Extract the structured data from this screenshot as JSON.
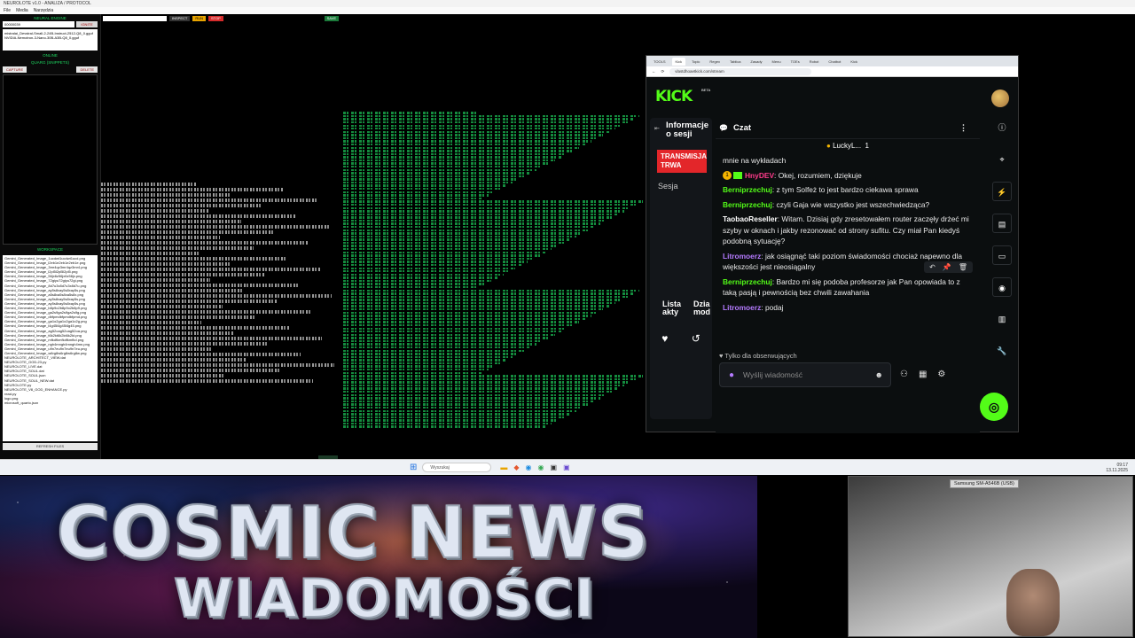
{
  "app": {
    "title": "NEUROLOTE v1.0 - ANALIZA / PROTOCOL",
    "menu": [
      "File",
      "Media",
      "Narzędzia"
    ]
  },
  "left_panel": {
    "engine_title": "NEURAL ENGINE",
    "engine_input": "00000039",
    "engine_button": "IGNITE",
    "model_text": "mistralai_Devstral-Small-2-24B-Instruct-2512-Q8_0.gguf NVIDIA-Nemotron-3-Nano-30B-A3B-Q8_0.gguf",
    "status": "ONLINE",
    "snippets_title": "QUARG (SNIPPETS)",
    "capture_btn": "CAPTURE",
    "delete_btn": "DELETE",
    "workspace_title": "WORKSPACE",
    "files": [
      "Gemini_Generated_Image_1ucdwt1ucdwt1ucd.png",
      "Gemini_Generated_Image_l2eb1e2eb1e2eb1e.png",
      "Gemini_Generated_Image_3mr4qz3mr4qz3mr4.png",
      "Gemini_Generated_Image_l2pl5l2pl5l2pl5.png",
      "Gemini_Generated_Image_56jx6z56jx6z56jx.png",
      "Gemini_Generated_Image_72giyu72giyu72gi.png",
      "Gemini_Generated_Image_8d7u3x8d7u3x8d7u.png",
      "Gemini_Generated_Image_ay5s8xay5s8xay5s.png",
      "Gemini_Generated_Image_a5s8xa5s8xa5s8x.png",
      "Gemini_Generated_Image_ay5s8xay5s8xay5s.png",
      "Gemini_Generated_Image_ay5s8xay5s8xay5s.png",
      "Gemini_Generated_Image_b8p9o2b8p9o2b8p9.png",
      "Gemini_Generated_Image_ga2s9ga2s9ga2s9g.png",
      "Gemini_Generated_Image_dbfpmdbfpmdbfpmd.png",
      "Gemini_Generated_Image_ga1o2ga1o2ga1o2g.png",
      "Gemini_Generated_Image_l4g45l4g45l4g45.png",
      "Gemini_Generated_Image_ag52oag52oag52oa.png",
      "Gemini_Generated_Image_t6k2kt6k2kt6k2kt.png",
      "Gemini_Generated_Image_mfkdfkmfkdfkmfkd.png",
      "Gemini_Generated_Image_ngh4mngh4mngh4mn.png",
      "Gemini_Generated_Image_u9n7eu9n7eu9n7eu.png",
      "Gemini_Generated_Image_w6rg8w6rg8w6rg8w.png",
      "NEUROLOTE_ARCHITECT_VIEW.dat",
      "NEUROLOTE_GOD-23.py",
      "NEUROLOTE_LIVE.dat",
      "NEUROLOTE_SOUL.dat",
      "NEUROLOTE_SOUL.json",
      "NEUROLOTE_SOUL_NEW.dat",
      "NEUROLOTE.py",
      "NEUROLOTE_V8_GOD_ENHANCE.py",
      "read.py",
      "logo.png",
      "microsoft_quarto.json"
    ],
    "refresh_btn": "REFRESH FILES"
  },
  "mid_panel": {
    "inspect": "INSPECT",
    "run": "RUN",
    "stop": "STOP",
    "save": "SAVE",
    "send": "SEND"
  },
  "browser": {
    "tabs": [
      "TOOLS",
      "Kick",
      "Topic",
      "Regex",
      "Tablica",
      "Zasady",
      "Menu",
      "TOEs",
      "Robot",
      "Chatbot",
      "Kick"
    ],
    "url": "vlastdhoaetkick.com/stream"
  },
  "kick": {
    "logo": "KICK",
    "beta": "BETA",
    "session_title": "Informacje o sesji",
    "live_badge": "TRANSMISJA TRWA",
    "session_item": "Sesja",
    "bottom_left": "Lista akty",
    "bottom_right": "Dzia mod",
    "chat_title": "Czat",
    "pinned_user": "LuckyL...",
    "pinned_count": "1",
    "messages": [
      {
        "user": "",
        "color": "white",
        "text": "mnie na wykładach"
      },
      {
        "user": "HnyDEV",
        "color": "pink",
        "badges": true,
        "text": "Okej, rozumiem, dziękuje"
      },
      {
        "user": "Berniprzechuj",
        "color": "green",
        "text": "z tym Solfeż to jest bardzo ciekawa sprawa"
      },
      {
        "user": "Berniprzechuj",
        "color": "green",
        "text": "czyli Gaja wie wszystko jest wszechwiedząca?"
      },
      {
        "user": "TaobaoReseller",
        "color": "white",
        "text": "Witam. Dzisiaj gdy zresetowałem router zaczęły drżeć mi szyby w oknach i jakby rezonować od strony sufitu. Czy miał Pan kiedyś podobną sytuację?"
      },
      {
        "user": "Litromoerz",
        "color": "purple",
        "text": "jak osiągnąć taki poziom świadomości chociaż napewno dla większości jest nieosiągalny"
      },
      {
        "user": "Berniprzechuj",
        "color": "green",
        "text": "Bardzo mi się podoba profesorze jak Pan opowiada to z taką pasją i pewnością bez chwili zawahania"
      },
      {
        "user": "Litromoerz",
        "color": "purple",
        "text": "podaj"
      }
    ],
    "followers_only": "Tylko dla obserwujących",
    "input_placeholder": "Wyślij wiadomość"
  },
  "taskbar": {
    "search": "Wyszukaj",
    "time": "09:17",
    "date": "13.11.2025"
  },
  "banner": {
    "title": "COSMIC NEWS",
    "subtitle": "WIADOMOŚCI"
  },
  "webcam": {
    "label": "Samsung SM-A546B (USB)"
  }
}
